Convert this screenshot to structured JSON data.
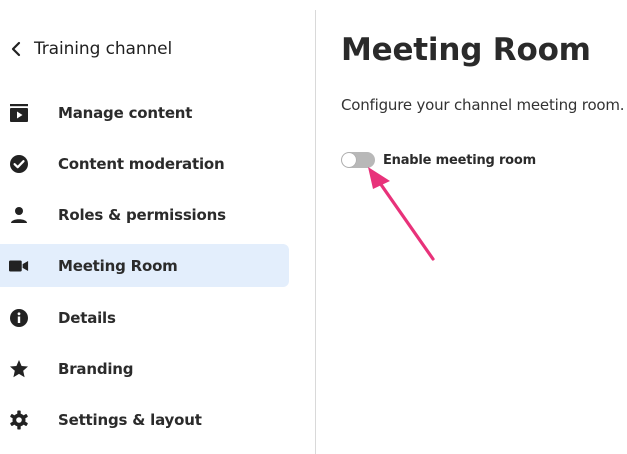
{
  "sidebar": {
    "back_label": "Training channel",
    "items": [
      {
        "label": "Manage content",
        "icon": "video-library-icon",
        "active": false
      },
      {
        "label": "Content moderation",
        "icon": "check-circle-icon",
        "active": false
      },
      {
        "label": "Roles & permissions",
        "icon": "person-icon",
        "active": false
      },
      {
        "label": "Meeting Room",
        "icon": "videocam-icon",
        "active": true
      },
      {
        "label": "Details",
        "icon": "info-icon",
        "active": false
      },
      {
        "label": "Branding",
        "icon": "star-icon",
        "active": false
      },
      {
        "label": "Settings & layout",
        "icon": "gear-icon",
        "active": false
      }
    ]
  },
  "main": {
    "title": "Meeting Room",
    "subtitle": "Configure your channel meeting room.",
    "toggle": {
      "label": "Enable meeting room",
      "checked": false
    }
  },
  "colors": {
    "active_bg": "#e3eefc",
    "annotation_arrow": "#e8327a",
    "toggle_off": "#b8b8b8"
  }
}
